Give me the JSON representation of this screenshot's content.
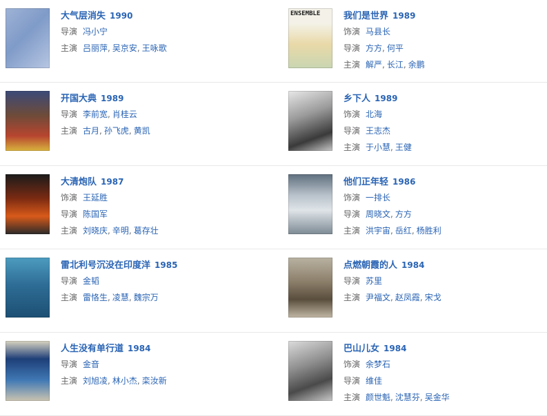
{
  "movies": [
    {
      "title": "大气层消失",
      "year": "1990",
      "credits": [
        {
          "label": "导演",
          "names": [
            "冯小宁"
          ]
        },
        {
          "label": "主演",
          "names": [
            "吕丽萍",
            "吴京安",
            "王咏歌"
          ]
        }
      ]
    },
    {
      "title": "我们是世界",
      "year": "1989",
      "poster_text": "ENSEMBLE",
      "credits": [
        {
          "label": "饰演",
          "names": [
            "马县长"
          ]
        },
        {
          "label": "导演",
          "names": [
            "方方",
            "何平"
          ]
        },
        {
          "label": "主演",
          "names": [
            "解严",
            "长江",
            "余鹏"
          ]
        }
      ]
    },
    {
      "title": "开国大典",
      "year": "1989",
      "credits": [
        {
          "label": "导演",
          "names": [
            "李前宽",
            "肖桂云"
          ]
        },
        {
          "label": "主演",
          "names": [
            "古月",
            "孙飞虎",
            "黄凯"
          ]
        }
      ]
    },
    {
      "title": "乡下人",
      "year": "1989",
      "credits": [
        {
          "label": "饰演",
          "names": [
            "北海"
          ]
        },
        {
          "label": "导演",
          "names": [
            "王志杰"
          ]
        },
        {
          "label": "主演",
          "names": [
            "于小慧",
            "王健"
          ]
        }
      ]
    },
    {
      "title": "大清炮队",
      "year": "1987",
      "credits": [
        {
          "label": "饰演",
          "names": [
            "王延胜"
          ]
        },
        {
          "label": "导演",
          "names": [
            "陈国军"
          ]
        },
        {
          "label": "主演",
          "names": [
            "刘晓庆",
            "辛明",
            "葛存壮"
          ]
        }
      ]
    },
    {
      "title": "他们正年轻",
      "year": "1986",
      "credits": [
        {
          "label": "饰演",
          "names": [
            "一排长"
          ]
        },
        {
          "label": "导演",
          "names": [
            "周晓文",
            "方方"
          ]
        },
        {
          "label": "主演",
          "names": [
            "洪宇宙",
            "岳红",
            "杨胜利"
          ]
        }
      ]
    },
    {
      "title": "雷北利号沉没在印度洋",
      "year": "1985",
      "credits": [
        {
          "label": "导演",
          "names": [
            "金韬"
          ]
        },
        {
          "label": "主演",
          "names": [
            "雷恪生",
            "凌慧",
            "魏宗万"
          ]
        }
      ]
    },
    {
      "title": "点燃朝霞的人",
      "year": "1984",
      "credits": [
        {
          "label": "导演",
          "names": [
            "苏里"
          ]
        },
        {
          "label": "主演",
          "names": [
            "尹福文",
            "赵凤霞",
            "宋戈"
          ]
        }
      ]
    },
    {
      "title": "人生没有单行道",
      "year": "1984",
      "credits": [
        {
          "label": "导演",
          "names": [
            "金音"
          ]
        },
        {
          "label": "主演",
          "names": [
            "刘旭凌",
            "林小杰",
            "栾汝新"
          ]
        }
      ]
    },
    {
      "title": "巴山儿女",
      "year": "1984",
      "credits": [
        {
          "label": "饰演",
          "names": [
            "余梦石"
          ]
        },
        {
          "label": "导演",
          "names": [
            "维佳"
          ]
        },
        {
          "label": "主演",
          "names": [
            "颜世魁",
            "沈慧芬",
            "吴金华"
          ]
        }
      ]
    }
  ],
  "colors": {
    "link": "#2a64b4",
    "label": "#666666",
    "divider": "#e8e8e8"
  }
}
